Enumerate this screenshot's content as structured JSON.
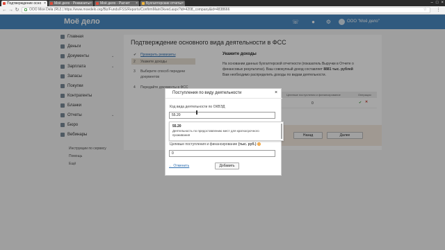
{
  "browser": {
    "tabs": [
      {
        "label": "Подтверждение осно"
      },
      {
        "label": "Моё дело - Реквизиты"
      },
      {
        "label": "Моё дело - Расчет"
      },
      {
        "label": "Бухгалтерские отчеты"
      }
    ],
    "url": "ООО Моя Dela (RU) | https://www.moedelo.org/Biz/Funds/FSS/Reports/ConfirmMainOkved.aspx?id=4208_company&id=4838666"
  },
  "header": {
    "brand": "Моё дело",
    "company": "ООО \"Моё дело\""
  },
  "sidebar": {
    "items": [
      {
        "label": "Главная"
      },
      {
        "label": "Деньги"
      },
      {
        "label": "Документы"
      },
      {
        "label": "Зарплата"
      },
      {
        "label": "Запасы"
      },
      {
        "label": "Покупки"
      },
      {
        "label": "Контрагенты"
      },
      {
        "label": "Бланки"
      },
      {
        "label": "Отчеты"
      },
      {
        "label": "Бюро"
      },
      {
        "label": "Вебинары"
      }
    ],
    "links": [
      "Инструкции по сервису",
      "Помощь",
      "Ещё"
    ]
  },
  "content": {
    "title": "Подтверждение основного вида деятельности в ФСС",
    "steps": [
      {
        "num": "✔",
        "label": "Проверить реквизиты"
      },
      {
        "num": "2",
        "label": "Укажите доходы"
      },
      {
        "num": "3",
        "label": "Выберите способ передачи"
      },
      {
        "num": "",
        "label": "документов"
      },
      {
        "num": "4",
        "label": "Передайте документы в ФСС"
      }
    ],
    "right_title": "Укажите доходы",
    "right_text_1": "На основании данных бухгалтерской отчетности (показатель Выручки в Отчете о",
    "right_text_2": "финансовых результатах). Ваш совокупный доход составляет",
    "right_text_amount": "8881 тыс. рублей",
    "right_text_3": "Вам необходимо распределить доходы по видам деятельности.",
    "table_col_target": "Целевые поступления и финансирование",
    "table_col_ops": "Операции",
    "row_value": "0",
    "back_button": "Назад",
    "next_button": "Далее"
  },
  "modal": {
    "title": "Поступления по виду деятельности",
    "okved_label": "Код вида деятельности по ОКВЭД",
    "okved_value": "55.20",
    "suggest_code": "55.20",
    "suggest_desc": "Деятельность по предоставлению мест для краткосрочного проживания",
    "target_label": "Целевые поступления и финансирование",
    "target_unit": "(тыс. руб.)",
    "target_value": "0",
    "cancel": "← Отменить",
    "add_button": "Добавить"
  },
  "colors": {
    "header_bg": "#4a8bc4",
    "link": "#2f6fb0",
    "highlight": "#f6ece0"
  }
}
